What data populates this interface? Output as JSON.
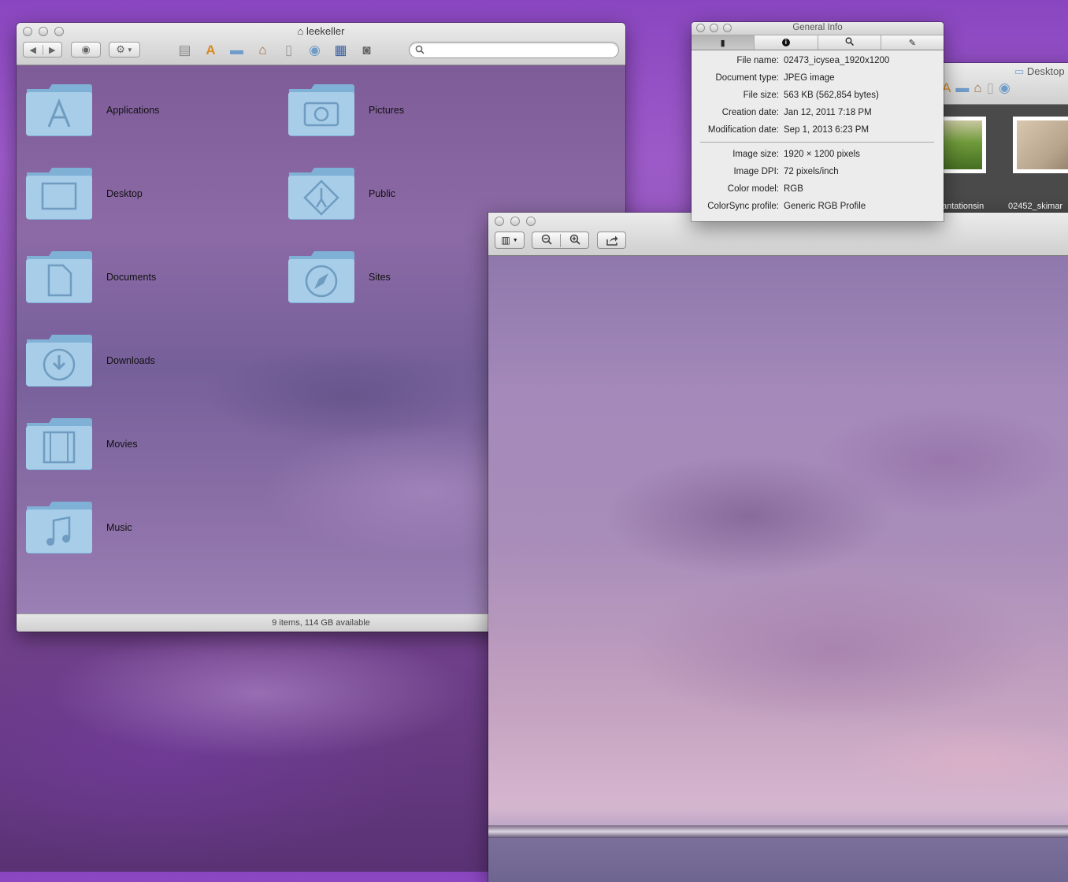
{
  "finder": {
    "title": "leekeller",
    "status": "9 items, 114 GB available",
    "items": [
      {
        "label": "Applications"
      },
      {
        "label": "Desktop"
      },
      {
        "label": "Documents"
      },
      {
        "label": "Downloads"
      },
      {
        "label": "Movies"
      },
      {
        "label": "Music"
      },
      {
        "label": "Pictures"
      },
      {
        "label": "Public"
      },
      {
        "label": "Sites"
      }
    ]
  },
  "back_window": {
    "title": "Desktop",
    "thumbs": [
      {
        "label": "antationsin"
      },
      {
        "label": "02452_skimar"
      }
    ]
  },
  "info": {
    "title": "General Info",
    "general": [
      {
        "k": "File name:",
        "v": "02473_icysea_1920x1200"
      },
      {
        "k": "Document type:",
        "v": "JPEG image"
      },
      {
        "k": "File size:",
        "v": "563 KB (562,854 bytes)"
      },
      {
        "k": "Creation date:",
        "v": "Jan 12, 2011 7:18 PM"
      },
      {
        "k": "Modification date:",
        "v": "Sep 1, 2013 6:23 PM"
      }
    ],
    "image": [
      {
        "k": "Image size:",
        "v": "1920 × 1200 pixels"
      },
      {
        "k": "Image DPI:",
        "v": "72 pixels/inch"
      },
      {
        "k": "Color model:",
        "v": "RGB"
      },
      {
        "k": "ColorSync profile:",
        "v": "Generic RGB Profile"
      }
    ]
  }
}
